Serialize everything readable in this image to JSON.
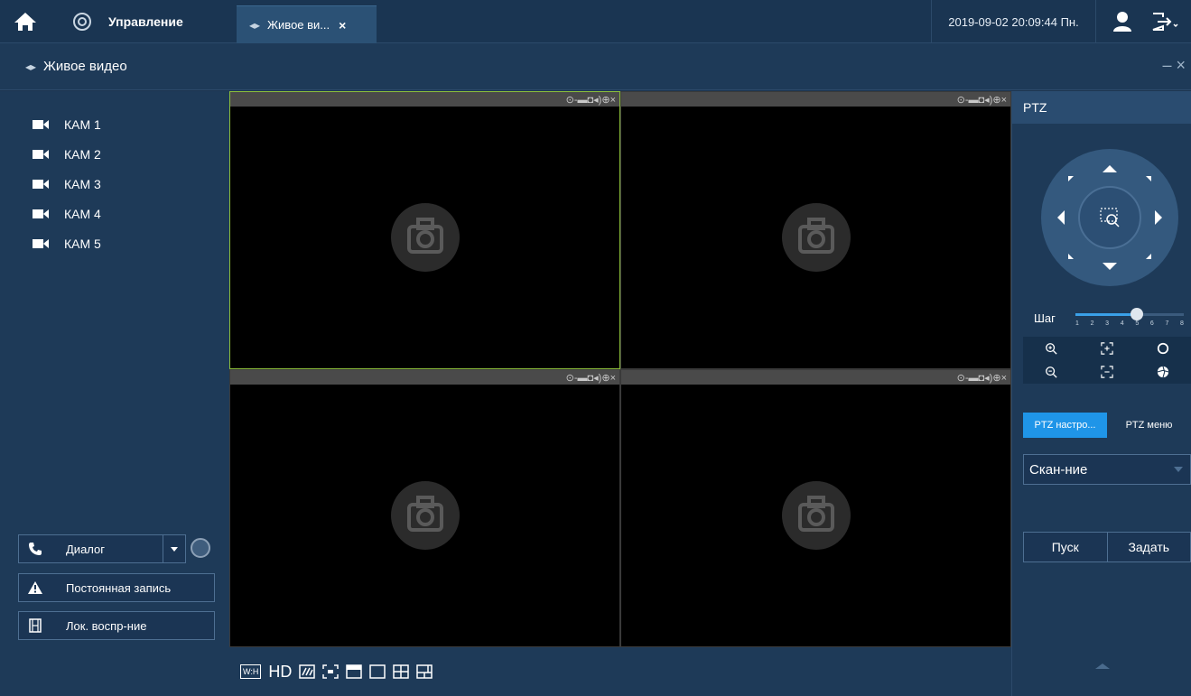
{
  "topbar": {
    "management_label": "Управление",
    "tab_label": "Живое ви...",
    "tab_close": "×",
    "datetime": "2019-09-02 20:09:44 Пн."
  },
  "subheader": {
    "title": "Живое видео",
    "controls": "– ×"
  },
  "cameras": [
    {
      "label": "КАМ 1"
    },
    {
      "label": "КАМ 2"
    },
    {
      "label": "КАМ 3"
    },
    {
      "label": "КАМ 4"
    },
    {
      "label": "КАМ 5"
    }
  ],
  "left_buttons": {
    "dialog_label": "Диалог",
    "permanent_record_label": "Постоянная запись",
    "local_playback_label": "Лок. воспр-ние"
  },
  "video_cell_toolbar": "⊙-▬◘◂)⊕×",
  "bottom_toolbar": {
    "aspect_label": "W:H",
    "hd_label": "HD"
  },
  "ptz": {
    "title": "PTZ",
    "step_label": "Шаг",
    "step_ticks": [
      "1",
      "2",
      "3",
      "4",
      "5",
      "6",
      "7",
      "8"
    ],
    "step_value": 5,
    "tab_settings": "PTZ настро...",
    "tab_menu": "PTZ меню",
    "select_value": "Скан-ние",
    "start_button": "Пуск",
    "set_button": "Задать"
  },
  "colors": {
    "panel": "#1e3a58",
    "accent": "#1f95e8",
    "active_cell_border": "#8dbf3a"
  }
}
